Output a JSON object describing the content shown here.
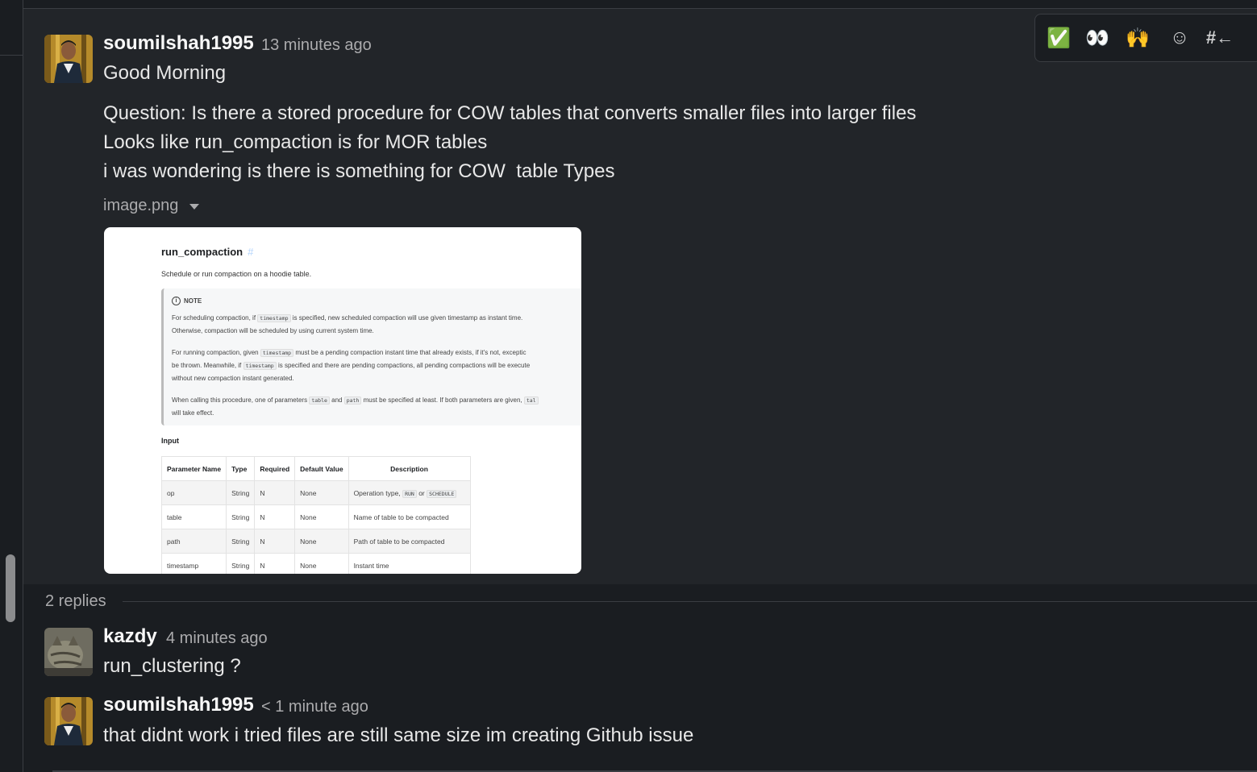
{
  "thread": {
    "parent": {
      "username": "soumilshah1995",
      "timestamp": "13 minutes ago",
      "lines": [
        "Good Morning",
        "Question: Is there a stored procedure for COW tables that converts smaller files into larger files",
        "Looks like run_compaction is for MOR tables",
        "i was wondering is there is something for COW  table Types"
      ],
      "attachment": {
        "filename": "image.png",
        "doc": {
          "title": "run_compaction",
          "title_anchor": "#",
          "subtitle": "Schedule or run compaction on a hoodie table.",
          "note_label": "NOTE",
          "note_p1_a": "For scheduling compaction, if",
          "note_p1_code": "timestamp",
          "note_p1_b": "is specified, new scheduled compaction will use given timestamp as instant time.",
          "note_p1_c": "Otherwise, compaction will be scheduled by using current system time.",
          "note_p2_a": "For running compaction, given",
          "note_p2_code": "timestamp",
          "note_p2_b": "must be a pending compaction instant time that already exists, if it's not, exceptic",
          "note_p2_c": "be thrown. Meanwhile, if",
          "note_p2_code2": "timestamp",
          "note_p2_d": "is specified and there are pending compactions, all pending compactions will be execute",
          "note_p2_e": "without new compaction instant generated.",
          "note_p3_a": "When calling this procedure, one of parameters",
          "note_p3_code1": "table",
          "note_p3_and": "and",
          "note_p3_code2": "path",
          "note_p3_b": "must be specified at least. If both parameters are given,",
          "note_p3_code3": "tal",
          "note_p3_c": "will take effect.",
          "input_heading": "Input",
          "table_headers": [
            "Parameter Name",
            "Type",
            "Required",
            "Default Value",
            "Description"
          ],
          "rows": [
            {
              "name": "op",
              "type": "String",
              "required": "N",
              "default": "None",
              "desc": "Operation type,",
              "code1": "RUN",
              "or": "or",
              "code2": "SCHEDULE"
            },
            {
              "name": "table",
              "type": "String",
              "required": "N",
              "default": "None",
              "desc": "Name of table to be compacted"
            },
            {
              "name": "path",
              "type": "String",
              "required": "N",
              "default": "None",
              "desc": "Path of table to be compacted"
            },
            {
              "name": "timestamp",
              "type": "String",
              "required": "N",
              "default": "None",
              "desc": "Instant time"
            }
          ]
        }
      }
    },
    "replies_label": "2 replies",
    "replies": [
      {
        "username": "kazdy",
        "timestamp": "4 minutes ago",
        "text": "run_clustering ?"
      },
      {
        "username": "soumilshah1995",
        "timestamp": "< 1 minute ago",
        "text": "that didnt work i tried files are still same size im creating Github issue"
      }
    ]
  },
  "toolbar": {
    "buttons": [
      {
        "icon": "white-check-mark-icon",
        "glyph": "✅"
      },
      {
        "icon": "eyes-icon",
        "glyph": "👀"
      },
      {
        "icon": "raised-hands-icon",
        "glyph": "🙌"
      },
      {
        "icon": "add-reaction-icon",
        "glyph": "☺"
      },
      {
        "icon": "reply-in-channel-icon",
        "glyph": "#←"
      }
    ]
  },
  "colors": {
    "background": "#1a1d21",
    "highlight": "#222529",
    "text": "#d1d2d3",
    "muted": "#ababad"
  }
}
